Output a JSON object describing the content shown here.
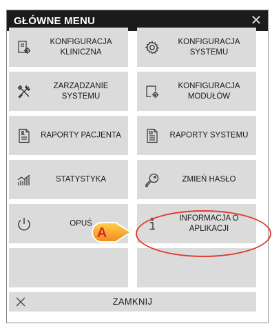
{
  "window": {
    "title": "GŁÓWNE MENU",
    "close_glyph": "✕"
  },
  "tiles": [
    {
      "label": "KONFIGURACJA\nKLINICZNA",
      "icon": "clinical-config-icon"
    },
    {
      "label": "KONFIGURACJA\nSYSTEMU",
      "icon": "gear-icon"
    },
    {
      "label": "ZARZĄDZANIE\nSYSTEMU",
      "icon": "tools-icon"
    },
    {
      "label": "KONFIGURACJA\nMODUŁÓW",
      "icon": "module-config-icon"
    },
    {
      "label": "RAPORTY PACJENTA",
      "icon": "patient-report-icon"
    },
    {
      "label": "RAPORTY SYSTEMU",
      "icon": "system-report-icon"
    },
    {
      "label": "STATYSTYKA",
      "icon": "statistics-icon"
    },
    {
      "label": "ZMIEŃ HASŁO",
      "icon": "key-icon"
    },
    {
      "label": "OPUŚ",
      "icon": "power-icon"
    },
    {
      "label": "INFORMACJA O\nAPLIKACJI",
      "icon": "info-icon"
    },
    {
      "label": "",
      "icon": ""
    },
    {
      "label": "",
      "icon": ""
    }
  ],
  "footer": {
    "close_label": "ZAMKNIJ",
    "close_icon": "close-icon"
  },
  "annotation": {
    "marker_letter": "A",
    "accent_color": "#e03a2e",
    "marker_fill": "#f5a623"
  }
}
